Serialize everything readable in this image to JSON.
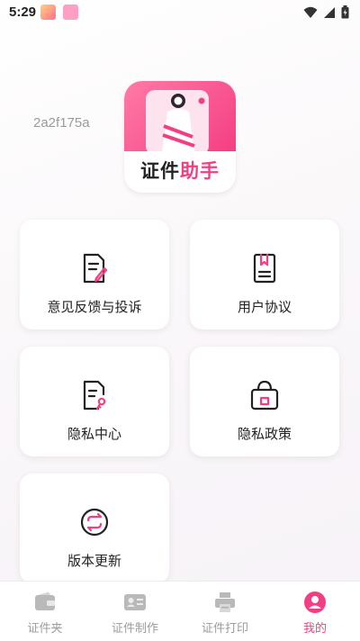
{
  "status_bar": {
    "time": "5:29"
  },
  "device_id": "2a2f175a",
  "logo": {
    "text_a": "证件",
    "text_b": "助手"
  },
  "menu": [
    {
      "label": "意见反馈与投诉",
      "icon": "feedback-edit-icon"
    },
    {
      "label": "用户协议",
      "icon": "agreement-book-icon"
    },
    {
      "label": "隐私中心",
      "icon": "privacy-key-icon"
    },
    {
      "label": "隐私政策",
      "icon": "policy-bag-icon"
    },
    {
      "label": "版本更新",
      "icon": "refresh-icon"
    }
  ],
  "tabs": [
    {
      "label": "证件夹",
      "icon": "wallet-icon"
    },
    {
      "label": "证件制作",
      "icon": "id-card-icon"
    },
    {
      "label": "证件打印",
      "icon": "printer-icon"
    },
    {
      "label": "我的",
      "icon": "user-icon",
      "active": true
    }
  ],
  "colors": {
    "accent": "#f43e83",
    "inactive": "#9c9c9c",
    "icon_stroke": "#222222"
  }
}
